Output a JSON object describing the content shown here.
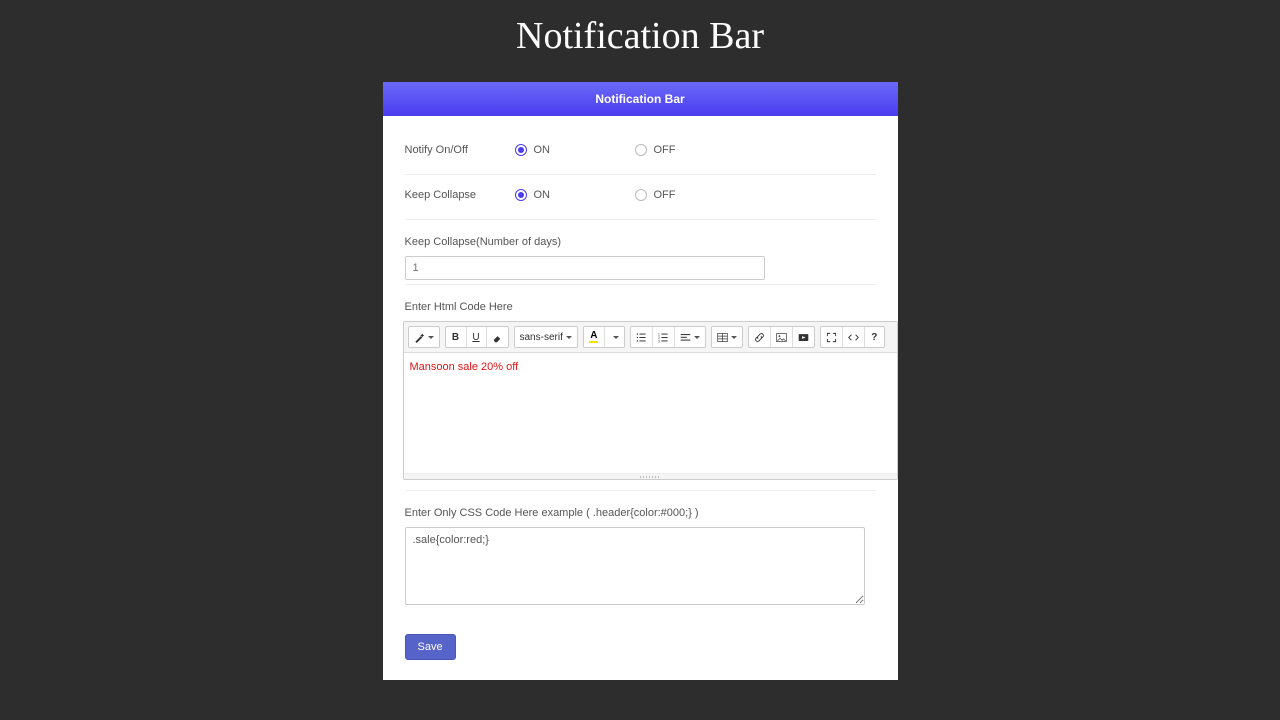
{
  "page_heading": "Notification Bar",
  "panel_title": "Notification Bar",
  "notify": {
    "label": "Notify On/Off",
    "on": "ON",
    "off": "OFF"
  },
  "keep_collapse": {
    "label": "Keep Collapse",
    "on": "ON",
    "off": "OFF"
  },
  "collapse_days": {
    "label": "Keep Collapse(Number of days)",
    "placeholder": "1",
    "value": ""
  },
  "html_editor": {
    "label": "Enter Html Code Here",
    "font_family": "sans-serif",
    "content": "Mansoon sale 20% off"
  },
  "css_box": {
    "label": "Enter Only CSS Code Here example ( .header{color:#000;} )",
    "value": ".sale{color:red;}"
  },
  "save_label": "Save"
}
